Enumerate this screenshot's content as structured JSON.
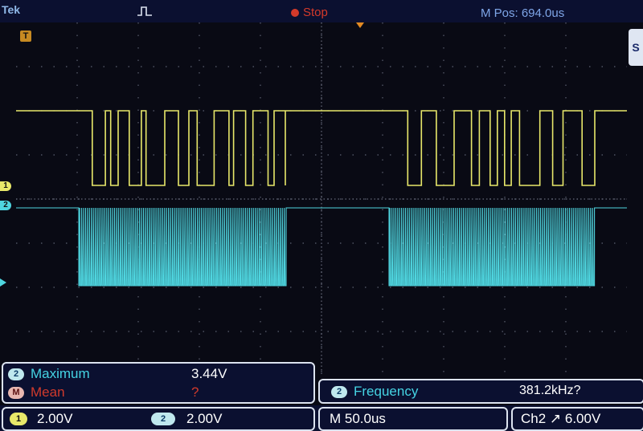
{
  "header": {
    "brand": "Tek",
    "run_state": "Stop",
    "m_pos": "M Pos: 694.0us",
    "trigger_marker": "T",
    "ch1_marker": "1",
    "ch2_marker": "2"
  },
  "side_menu": {
    "label": "S"
  },
  "measurements": {
    "rows": [
      {
        "badge": "2",
        "label": "Maximum",
        "value": "3.44V"
      },
      {
        "badge": "M",
        "label": "Mean",
        "value": "?"
      }
    ],
    "frequency": {
      "badge": "2",
      "label": "Frequency",
      "value": "381.2kHz?"
    }
  },
  "bottom_bar": {
    "ch1_badge": "1",
    "ch1_scale": "2.00V",
    "ch2_badge": "2",
    "ch2_scale": "2.00V",
    "timebase": "M 50.0us",
    "trigger": "Ch2 ↗ 6.00V"
  },
  "colors": {
    "ch1": "#e8e86a",
    "ch2": "#4fd6e0",
    "stop": "#d43a2a",
    "background": "#090a14"
  }
}
